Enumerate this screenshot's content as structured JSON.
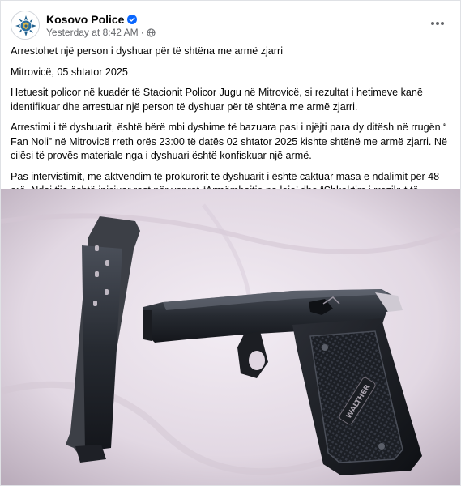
{
  "post": {
    "page_name": "Kosovo Police",
    "timestamp": "Yesterday at 8:42 AM",
    "separator": "·",
    "icons": {
      "avatar": "police-emblem-icon",
      "verified": "verified-badge-icon",
      "audience": "globe-icon",
      "menu": "more-options-icon"
    },
    "colors": {
      "verified": "#0866ff",
      "meta_text": "#65676b"
    },
    "paragraphs": [
      "Arrestohet një person i dyshuar për të shtëna me armë zjarri",
      "Mitrovicë, 05 shtator 2025",
      "Hetuesit policor në kuadër të Stacionit Policor Jugu në Mitrovicë, si rezultat i hetimeve kanë identifikuar dhe arrestuar një person të dyshuar për të shtëna me armë zjarri.",
      "Arrestimi i të dyshuarit, është bërë mbi dyshime të bazuara  pasi i njëjti para dy ditësh  në rrugën “ Fan Noli” në Mitrovicë  rreth  orës 23:00 të datës 02 shtator 2025 kishte shtënë me armë zjarri. Në cilësi të provës materiale nga i dyshuari  është konfiskuar një armë.",
      "Pas intervistimit, me aktvendim të prokurorit të dyshuarit i është caktuar masa e ndalimit për 48 orë. Ndaj tije është iniciuar rast për veprat “Armëmbajtje pa leje’ dhe “Shkaktim i rrezikut të përgjithshëm”."
    ],
    "photo": {
      "subject": "seized-pistol-and-magazine",
      "grip_engraving": "WALTHER"
    }
  }
}
